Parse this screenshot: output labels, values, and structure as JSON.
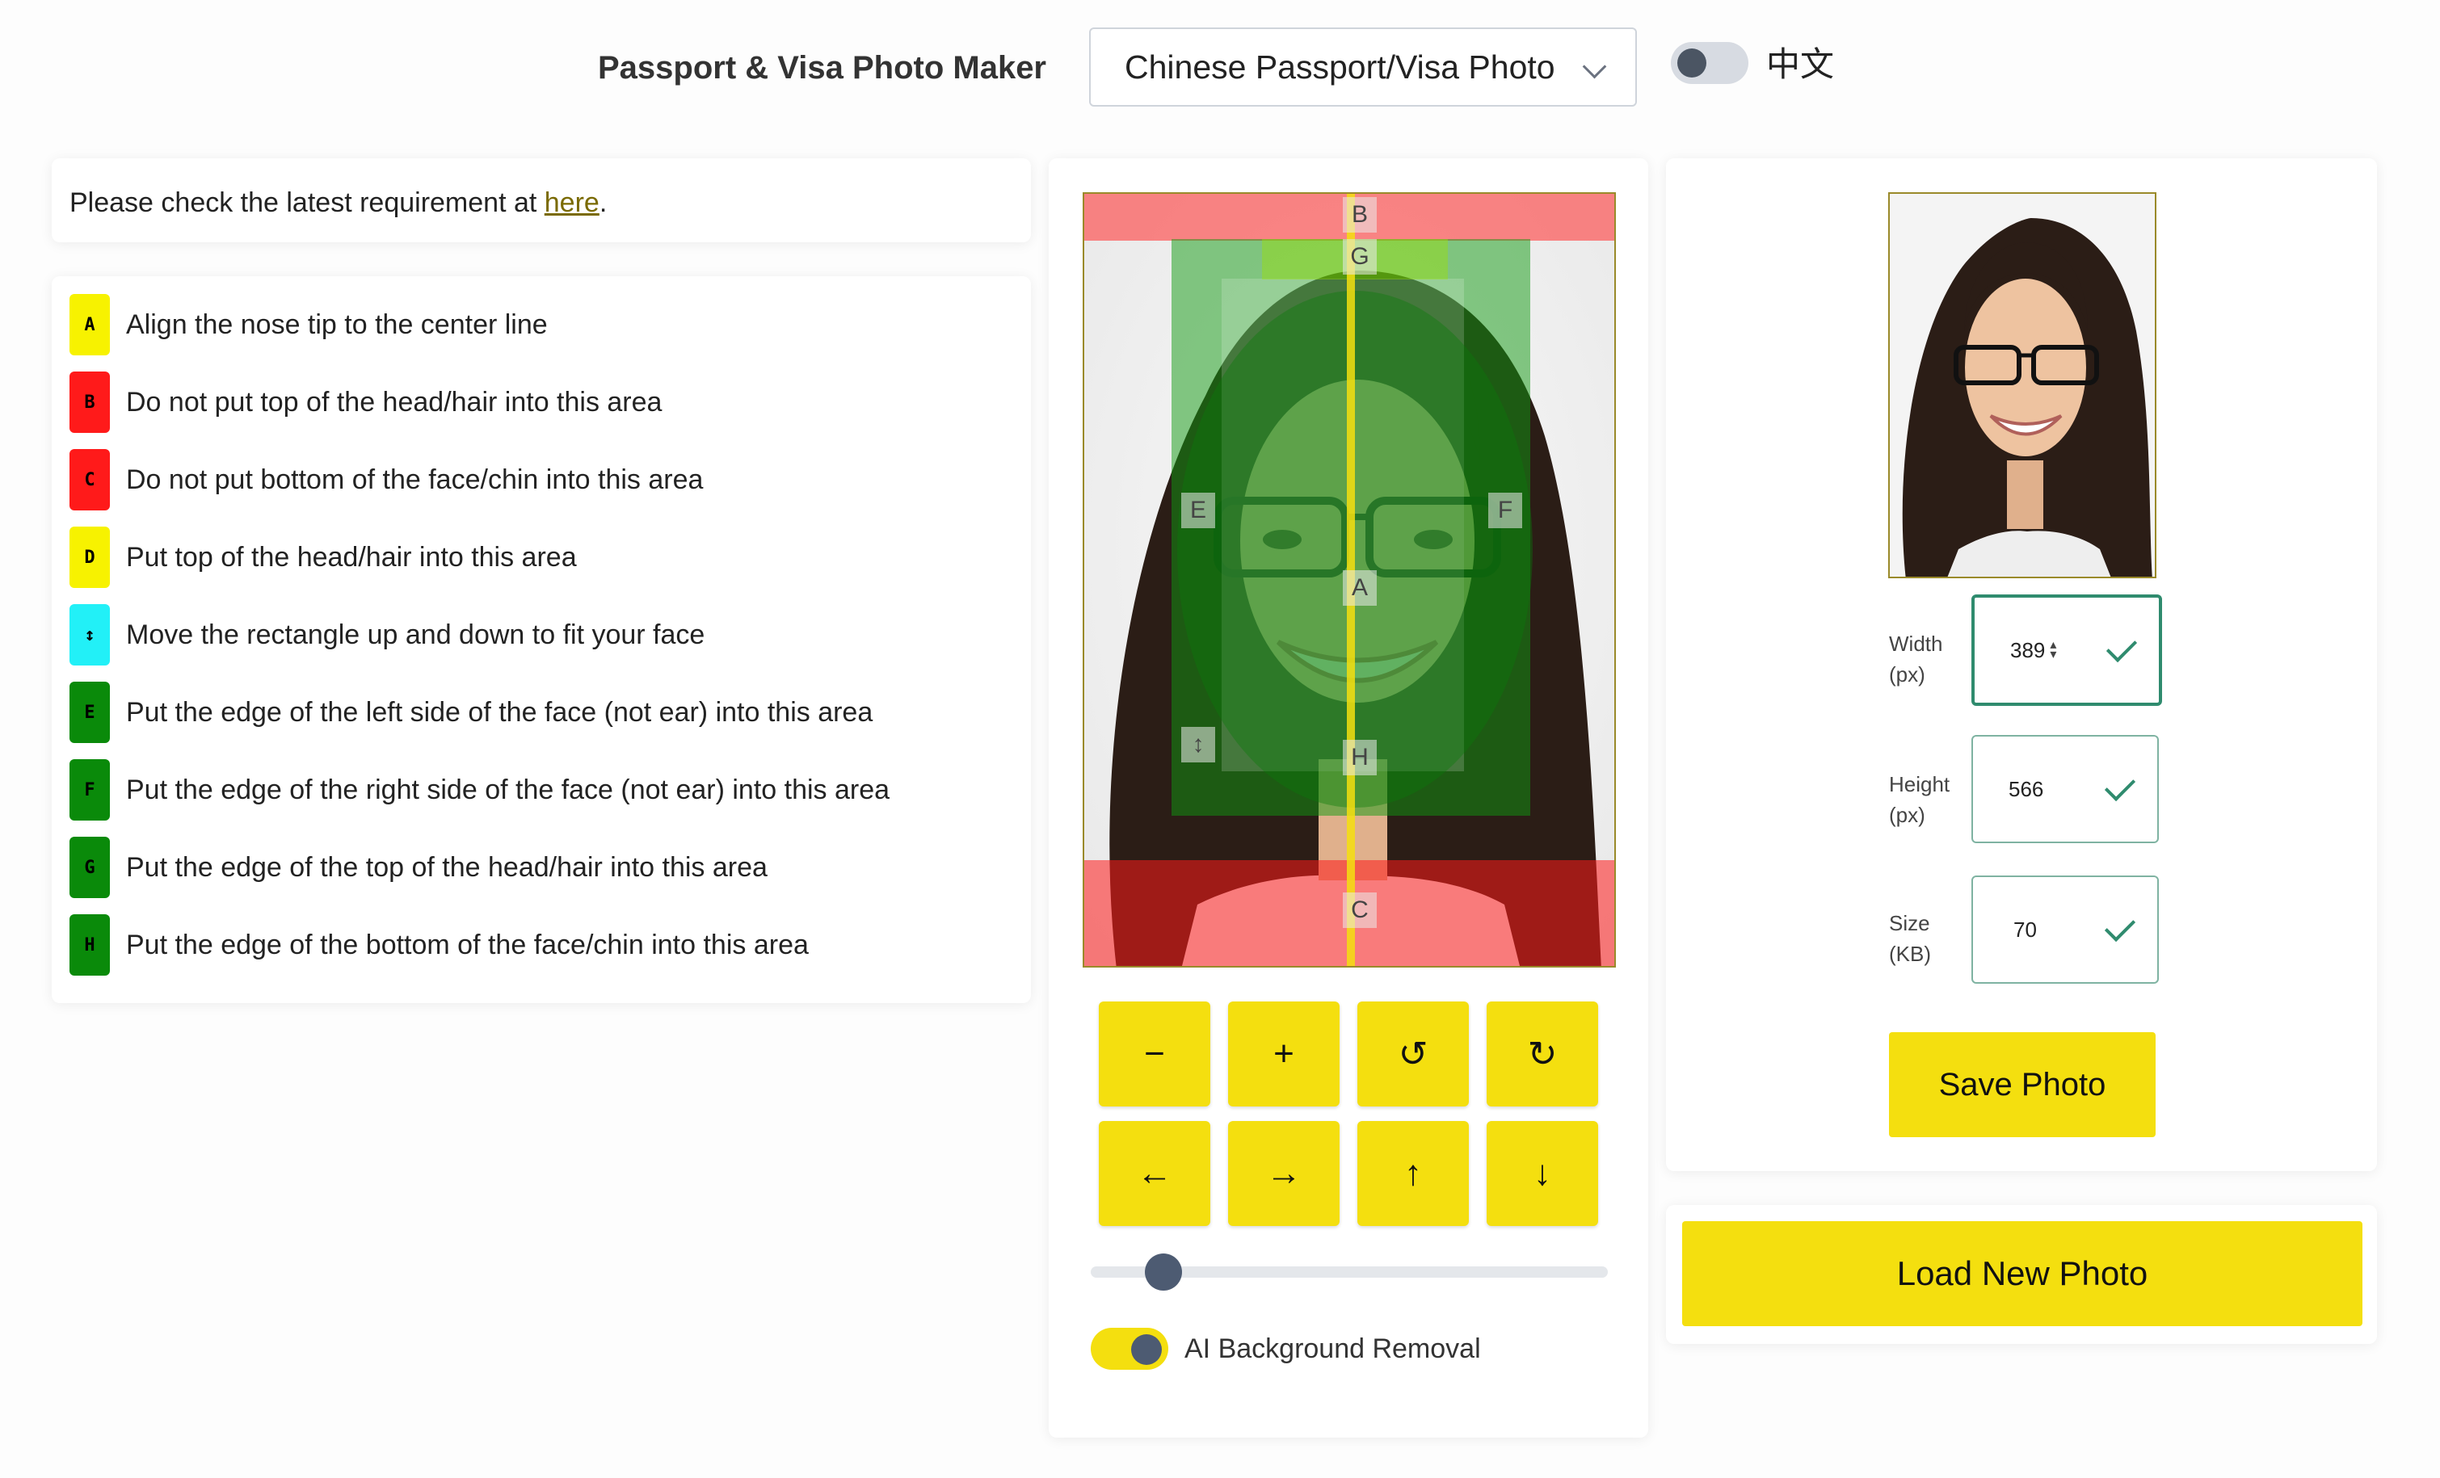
{
  "header": {
    "title": "Passport & Visa Photo Maker",
    "photo_type_selected": "Chinese Passport/Visa Photo",
    "language_label": "中文"
  },
  "requirement": {
    "text_before": "Please check the latest requirement at ",
    "link_text": "here",
    "text_after": "."
  },
  "legend": [
    {
      "key": "A",
      "color": "#f7f200",
      "text": "Align the nose tip to the center line"
    },
    {
      "key": "B",
      "color": "#ff1a1a",
      "text": "Do not put top of the head/hair into this area"
    },
    {
      "key": "C",
      "color": "#ff1a1a",
      "text": "Do not put bottom of the face/chin into this area"
    },
    {
      "key": "D",
      "color": "#f7f200",
      "text": "Put top of the head/hair into this area"
    },
    {
      "key": "↕",
      "color": "#22f0f7",
      "text": "Move the rectangle up and down to fit your face"
    },
    {
      "key": "E",
      "color": "#0a8a0a",
      "text": "Put the edge of the left side of the face (not ear) into this area"
    },
    {
      "key": "F",
      "color": "#0a8a0a",
      "text": "Put the edge of the right side of the face (not ear) into this area"
    },
    {
      "key": "G",
      "color": "#0a8a0a",
      "text": "Put the edge of the top of the head/hair into this area"
    },
    {
      "key": "H",
      "color": "#0a8a0a",
      "text": "Put the edge of the bottom of the face/chin into this area"
    }
  ],
  "overlay_labels": {
    "A": "A",
    "B": "B",
    "C": "C",
    "E": "E",
    "F": "F",
    "G": "G",
    "H": "H",
    "move": "↕"
  },
  "controls": {
    "zoom_out": "−",
    "zoom_in": "+",
    "rotate_left": "↺",
    "rotate_right": "↻",
    "move_left": "←",
    "move_right": "→",
    "move_up": "↑",
    "move_down": "↓"
  },
  "zoom_slider_fraction": 0.14,
  "ai_background_removal": {
    "label": "AI Background Removal",
    "enabled": true
  },
  "output": {
    "width_label": "Width",
    "width_unit": "(px)",
    "width_value": "389",
    "height_label": "Height",
    "height_unit": "(px)",
    "height_value": "566",
    "size_label": "Size",
    "size_unit": "(KB)",
    "size_value": "70"
  },
  "save_button": "Save Photo",
  "load_button": "Load New Photo",
  "colors": {
    "accent": "#f4df0f",
    "valid": "#2f8b6e",
    "danger_zone": "#ff3b3b",
    "guide_green": "#1f9a1f"
  }
}
